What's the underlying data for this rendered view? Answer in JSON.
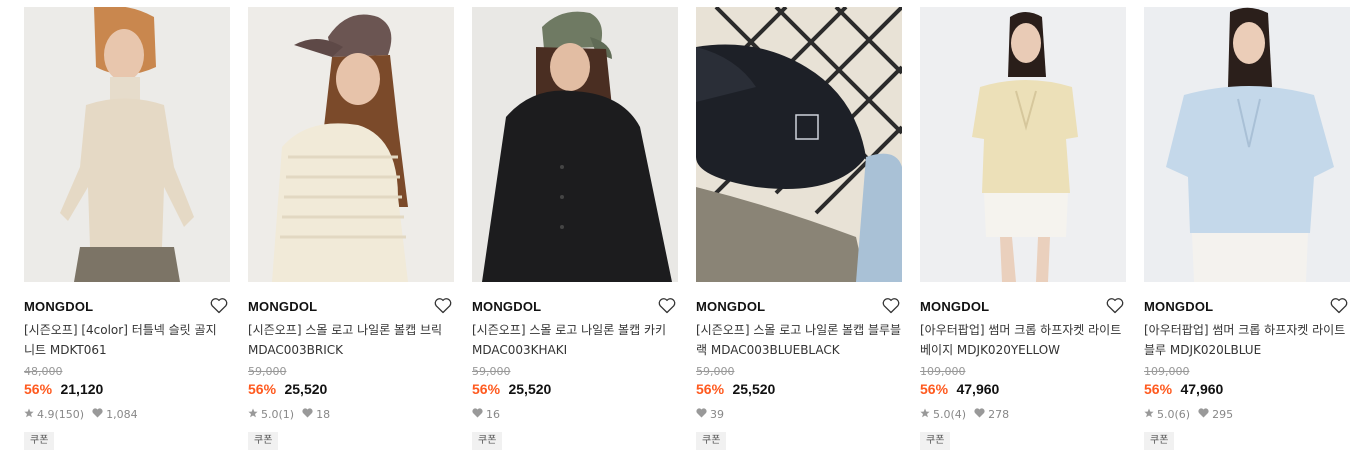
{
  "products": [
    {
      "brand": "MONGDOL",
      "title": "[시즌오프] [4color] 터틀넥 슬릿 골지 니트 MDKT061",
      "original_price": "48,000",
      "discount": "56%",
      "sale_price": "21,120",
      "rating": "4.9",
      "review_count": "(150)",
      "likes": "1,084",
      "badge": "쿠폰"
    },
    {
      "brand": "MONGDOL",
      "title": "[시즌오프] 스몰 로고 나일론 볼캡 브릭 MDAC003BRICK",
      "original_price": "59,000",
      "discount": "56%",
      "sale_price": "25,520",
      "rating": "5.0",
      "review_count": "(1)",
      "likes": "18",
      "badge": "쿠폰"
    },
    {
      "brand": "MONGDOL",
      "title": "[시즌오프] 스몰 로고 나일론 볼캡 카키 MDAC003KHAKI",
      "original_price": "59,000",
      "discount": "56%",
      "sale_price": "25,520",
      "rating": "",
      "review_count": "",
      "likes": "16",
      "badge": "쿠폰"
    },
    {
      "brand": "MONGDOL",
      "title": "[시즌오프] 스몰 로고 나일론 볼캡 블루블랙 MDAC003BLUEBLACK",
      "original_price": "59,000",
      "discount": "56%",
      "sale_price": "25,520",
      "rating": "",
      "review_count": "",
      "likes": "39",
      "badge": "쿠폰"
    },
    {
      "brand": "MONGDOL",
      "title": "[아우터팝업] 썸머 크롭 하프자켓 라이트베이지 MDJK020YELLOW",
      "original_price": "109,000",
      "discount": "56%",
      "sale_price": "47,960",
      "rating": "5.0",
      "review_count": "(4)",
      "likes": "278",
      "badge": "쿠폰"
    },
    {
      "brand": "MONGDOL",
      "title": "[아우터팝업] 썸머 크롭 하프자켓 라이트블루 MDJK020LBLUE",
      "original_price": "109,000",
      "discount": "56%",
      "sale_price": "47,960",
      "rating": "5.0",
      "review_count": "(6)",
      "likes": "295",
      "badge": "쿠폰"
    }
  ],
  "colors": {
    "discount": "#ff5a1f",
    "muted": "#999999",
    "badge_bg": "#f1f1f1"
  },
  "icons": [
    "heart-outline-icon",
    "star-icon",
    "heart-filled-icon"
  ]
}
